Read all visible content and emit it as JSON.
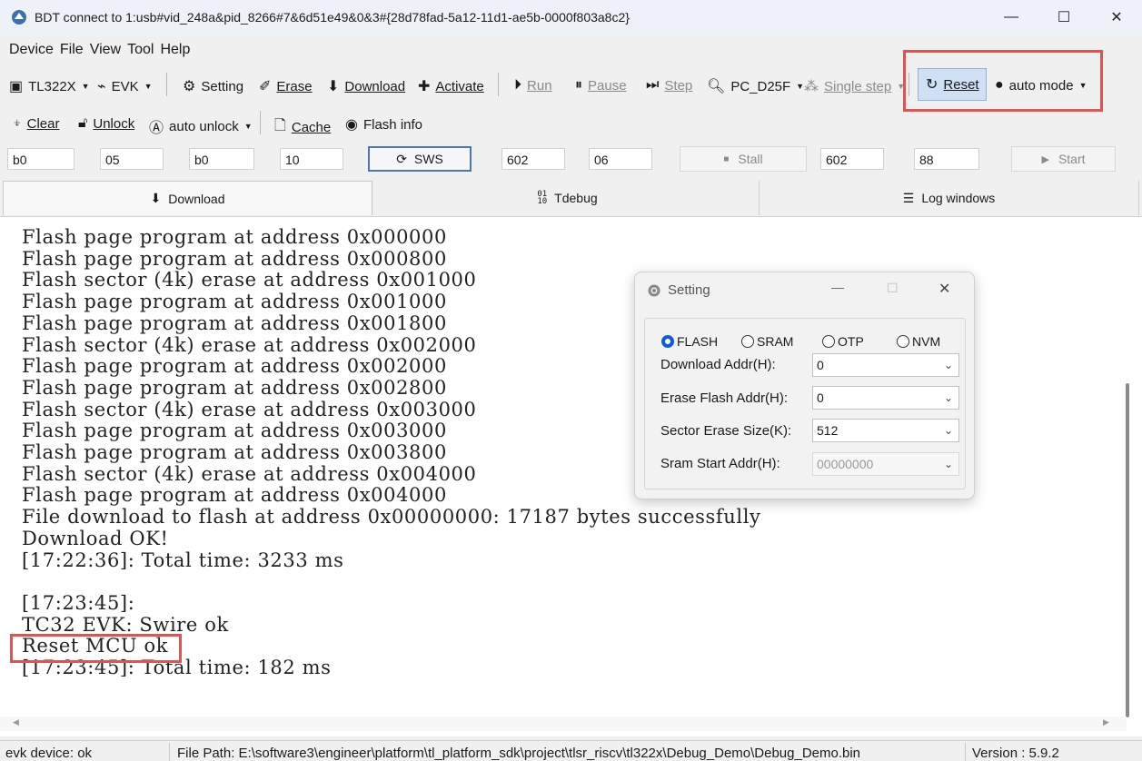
{
  "window": {
    "title": "BDT connect to 1:usb#vid_248a&pid_8266#7&6d51e49&0&3#{28d78fad-5a12-11d1-ae5b-0000f803a8c2}",
    "minimize": "—",
    "maximize": "☐",
    "close": "✕"
  },
  "menu": [
    "Device",
    "File",
    "View",
    "Tool",
    "Help"
  ],
  "toolbar1": {
    "chip": "TL322X",
    "evk": "EVK",
    "setting": "Setting",
    "erase": "Erase",
    "download": "Download",
    "activate": "Activate",
    "run": "Run",
    "pause": "Pause",
    "step": "Step",
    "pc": "PC_D25F",
    "single_step": "Single step",
    "reset": "Reset",
    "auto_mode": "auto mode"
  },
  "toolbar2": {
    "clear": "Clear",
    "unlock": "Unlock",
    "auto_unlock": "auto unlock",
    "cache": "Cache",
    "flash_info": "Flash info"
  },
  "toolbar3": {
    "f1": "b0",
    "f2": "05",
    "f3": "b0",
    "f4": "10",
    "sws": "SWS",
    "f5": "602",
    "f6": "06",
    "stall": "Stall",
    "f7": "602",
    "f8": "88",
    "start": "Start"
  },
  "tabs": [
    "Download",
    "Tdebug",
    "Log windows"
  ],
  "console": {
    "lines": [
      "Flash page program at address 0x000000",
      "Flash page program at address 0x000800",
      "Flash sector (4k) erase at address 0x001000",
      "Flash page program at address 0x001000",
      "Flash page program at address 0x001800",
      "Flash sector (4k) erase at address 0x002000",
      "Flash page program at address 0x002000",
      "Flash page program at address 0x002800",
      "Flash sector (4k) erase at address 0x003000",
      "Flash page program at address 0x003000",
      "Flash page program at address 0x003800",
      "Flash sector (4k) erase at address 0x004000",
      "Flash page program at address 0x004000",
      "File download to flash at address 0x00000000: 17187 bytes successfully",
      "Download OK!",
      "[17:22:36]: Total time: 3233 ms",
      "",
      "[17:23:45]:",
      "TC32 EVK: Swire ok",
      "Reset MCU ok",
      "[17:23:45]: Total time: 182 ms"
    ]
  },
  "dialog": {
    "title": "Setting",
    "radios": [
      "FLASH",
      "SRAM",
      "OTP",
      "NVM"
    ],
    "selected": "FLASH",
    "download_addr_label": "Download  Addr(H):",
    "download_addr": "0",
    "erase_addr_label": "Erase Flash Addr(H):",
    "erase_addr": "0",
    "sector_size_label": "Sector Erase Size(K):",
    "sector_size": "512",
    "sram_addr_label": "Sram Start Addr(H):",
    "sram_addr": "00000000"
  },
  "status": {
    "device": "evk device: ok",
    "file_path": "File Path:  E:\\software3\\engineer\\platform\\tl_platform_sdk\\project\\tlsr_riscv\\tl322x\\Debug_Demo\\Debug_Demo.bin",
    "version": "Version : 5.9.2"
  },
  "colors": {
    "highlight": "#e05353",
    "radio_selected": "#0b5cd5",
    "reset_button_bg": "#cfe0f5"
  }
}
